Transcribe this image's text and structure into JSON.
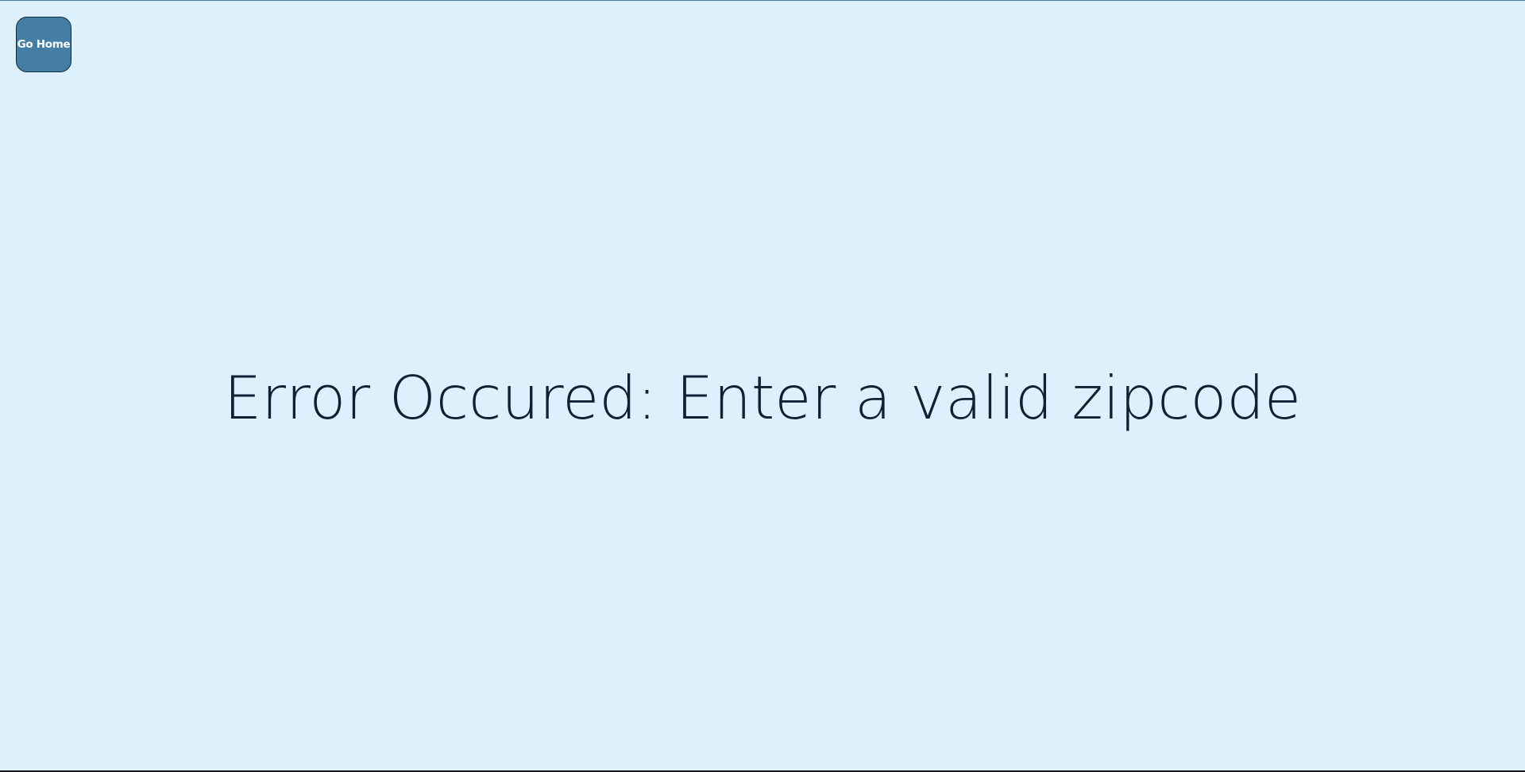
{
  "nav": {
    "home_button_label": "Go Home"
  },
  "error": {
    "message": "Error Occured: Enter a valid zipcode"
  },
  "colors": {
    "background": "#ddf1fc",
    "button": "#447ea5",
    "text": "#0d2233"
  }
}
